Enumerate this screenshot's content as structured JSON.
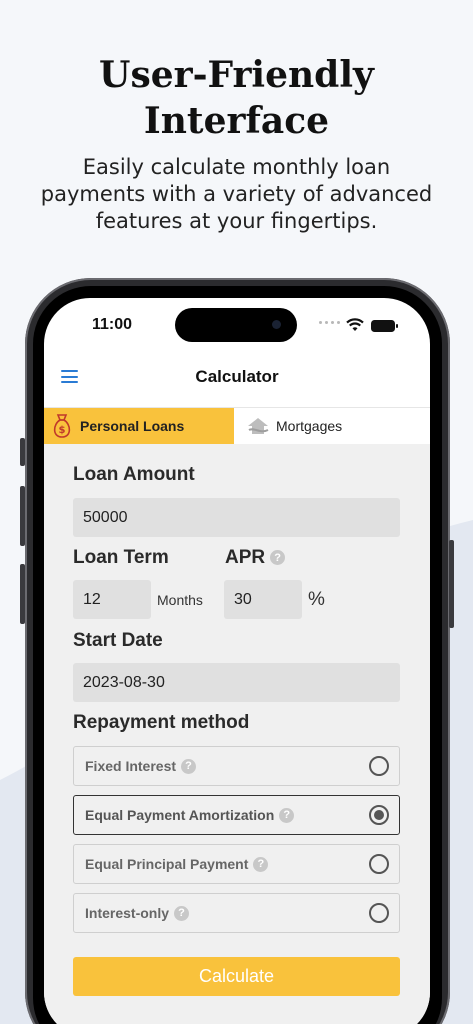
{
  "promo": {
    "headline_line1": "User-Friendly",
    "headline_line2": "Interface",
    "subtitle": "Easily calculate monthly loan payments with a variety of advanced features at your fingertips."
  },
  "status_bar": {
    "time": "11:00"
  },
  "navbar": {
    "title": "Calculator"
  },
  "tabs": [
    {
      "label": "Personal Loans",
      "active": true,
      "icon": "money-bag-icon"
    },
    {
      "label": "Mortgages",
      "active": false,
      "icon": "house-icon"
    }
  ],
  "form": {
    "loan_amount_label": "Loan Amount",
    "loan_amount_value": "50000",
    "loan_term_label": "Loan Term",
    "loan_term_value": "12",
    "loan_term_unit": "Months",
    "apr_label": "APR",
    "apr_value": "30",
    "apr_unit": "%",
    "start_date_label": "Start Date",
    "start_date_value": "2023-08-30",
    "repayment_label": "Repayment method",
    "repayment_options": [
      {
        "label": "Fixed Interest",
        "selected": false
      },
      {
        "label": "Equal Payment Amortization",
        "selected": true
      },
      {
        "label": "Equal Principal Payment",
        "selected": false
      },
      {
        "label": "Interest-only",
        "selected": false
      }
    ],
    "help_glyph": "?",
    "calculate_label": "Calculate"
  },
  "colors": {
    "accent": "#f9c23c",
    "menu_icon": "#2a7bd4",
    "field_bg": "#e0e0e0"
  }
}
